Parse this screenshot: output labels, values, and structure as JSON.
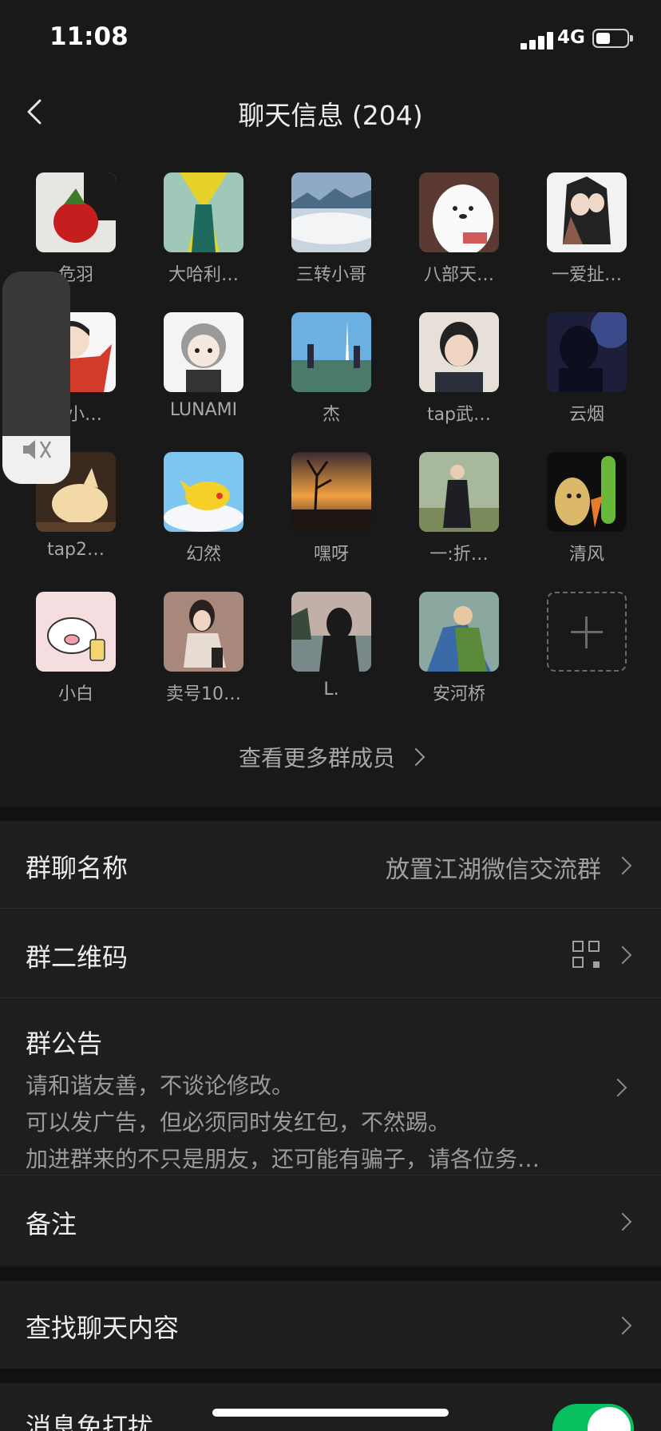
{
  "status_bar": {
    "time": "11:08",
    "network": "4G"
  },
  "nav": {
    "title": "聊天信息 (204)"
  },
  "members": [
    {
      "name": "危羽"
    },
    {
      "name": "大哈利…"
    },
    {
      "name": "三转小哥"
    },
    {
      "name": "八部天…"
    },
    {
      "name": "一爱扯…"
    },
    {
      "name": "诗小…"
    },
    {
      "name": "LUNAMI"
    },
    {
      "name": "杰"
    },
    {
      "name": "tap武…"
    },
    {
      "name": "云烟"
    },
    {
      "name": "tap2…"
    },
    {
      "name": "幻然"
    },
    {
      "name": "嘿呀"
    },
    {
      "name": "一:折…"
    },
    {
      "name": "清风"
    },
    {
      "name": "小白"
    },
    {
      "name": "卖号10…"
    },
    {
      "name": "L."
    },
    {
      "name": "安河桥"
    }
  ],
  "view_more": "查看更多群成员",
  "settings": {
    "group_name": {
      "label": "群聊名称",
      "value": "放置江湖微信交流群"
    },
    "qr_code": {
      "label": "群二维码",
      "icon": "qr-code-icon"
    },
    "notice": {
      "label": "群公告",
      "lines": [
        "请和谐友善，不谈论修改。",
        "可以发广告，但必须同时发红包，不然踢。",
        "加进群来的不只是朋友，还可能有骗子，请各位务…"
      ]
    },
    "remark": {
      "label": "备注"
    },
    "search": {
      "label": "查找聊天内容"
    },
    "dnd": {
      "label": "消息免打扰",
      "enabled": true
    }
  },
  "colors": {
    "accent": "#07c160",
    "background": "#191919",
    "cell": "#1e1e1e"
  }
}
